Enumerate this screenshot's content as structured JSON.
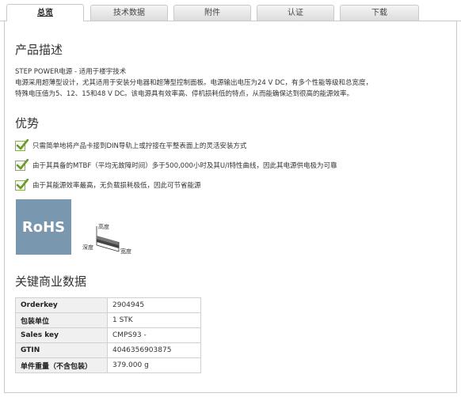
{
  "tabs": [
    {
      "label": "总览"
    },
    {
      "label": "技术数据"
    },
    {
      "label": "附件"
    },
    {
      "label": "认证"
    },
    {
      "label": "下载"
    }
  ],
  "description": {
    "heading": "产品描述",
    "line1": "STEP POWER电源 - 适用于楼宇技术",
    "line2": "电源采用超薄型设计，尤其适用于安装分电器和超薄型控制面板。电源输出电压为24 V DC，有多个性能等级和总宽度，",
    "line3": "特殊电压值为5、12、15和48 V DC。该电源具有效率高、停机损耗低的特点，从而能确保达到很高的能源效率。"
  },
  "advantages": {
    "heading": "优势",
    "items": [
      {
        "text": "只需简单地将产品卡接到DIN导轨上或拧接在平整表面上的灵活安装方式"
      },
      {
        "text": "由于其具备的MTBF（平均无故障时间）多于500,000小时及其U/I特性曲线，因此其电源供电极为可靠"
      },
      {
        "text": "由于其能源效率最高，无负载损耗极低，因此可节省能源"
      }
    ]
  },
  "rohs_label": "RoHS",
  "dimensions": {
    "height": "高度",
    "depth": "深度",
    "width": "宽度"
  },
  "business": {
    "heading": "关键商业数据",
    "rows": [
      {
        "key": "Orderkey",
        "value": "2904945"
      },
      {
        "key": "包装单位",
        "value": "1 STK"
      },
      {
        "key": "Sales key",
        "value": "CMPS93 -"
      },
      {
        "key": "GTIN",
        "value": "4046356903875"
      },
      {
        "key": "单件重量（不含包装）",
        "value": "379.000 g"
      }
    ]
  },
  "colors": {
    "accent_check": "#6a9a2a",
    "rohs_bg": "#7a97b0",
    "tab_border": "#c9c9c9"
  },
  "icons": {
    "check": "checkmark-icon"
  }
}
